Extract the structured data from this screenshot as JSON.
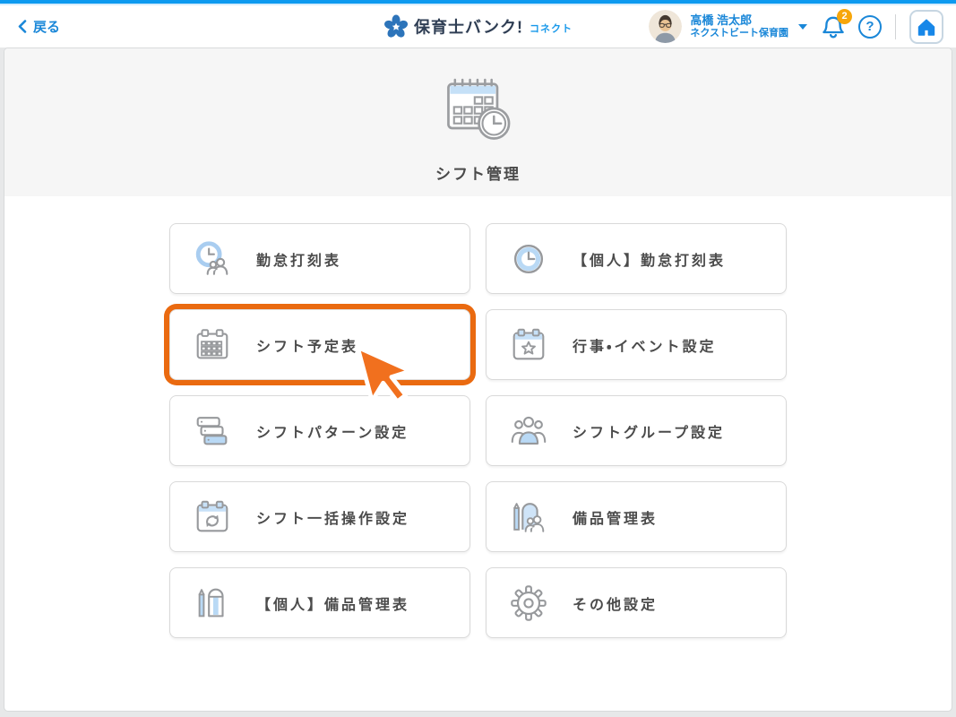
{
  "header": {
    "back_label": "戻る",
    "brand": {
      "name": "保育士バンク!",
      "sub": "コネクト"
    },
    "user": {
      "name": "高橋 浩太郎",
      "org": "ネクストビート保育園"
    },
    "notifications": {
      "count": "2"
    },
    "help_glyph": "?"
  },
  "hero": {
    "title": "シフト管理",
    "icon": "calendar-clock-icon"
  },
  "menu": {
    "items": [
      {
        "label": "勤怠打刻表",
        "icon": "clock-people-icon"
      },
      {
        "label": "【個人】勤怠打刻表",
        "icon": "clock-icon"
      },
      {
        "label": "シフト予定表",
        "icon": "calendar-grid-icon",
        "highlighted": true
      },
      {
        "label": "行事・イベント設定",
        "icon": "calendar-star-icon"
      },
      {
        "label": "シフトパターン設定",
        "icon": "stacked-cards-icon"
      },
      {
        "label": "シフトグループ設定",
        "icon": "people-group-icon"
      },
      {
        "label": "シフト一括操作設定",
        "icon": "calendar-sync-icon"
      },
      {
        "label": "備品管理表",
        "icon": "pencil-board-people-icon"
      },
      {
        "label": "【個人】備品管理表",
        "icon": "pencil-notebook-icon"
      },
      {
        "label": "その他設定",
        "icon": "gear-icon"
      }
    ]
  },
  "colors": {
    "accent_blue": "#1a87d8",
    "top_strip_blue": "#0d9af0",
    "brand_navy": "#2f3e54",
    "brand_sub_blue": "#1798ea",
    "highlight_orange": "#ea6a10",
    "cursor_orange": "#f1701e",
    "badge_amber": "#f7a60a",
    "icon_light_blue": "#b9d9f5",
    "icon_gray": "#97999c",
    "hero_bg": "#f6f6f6"
  }
}
